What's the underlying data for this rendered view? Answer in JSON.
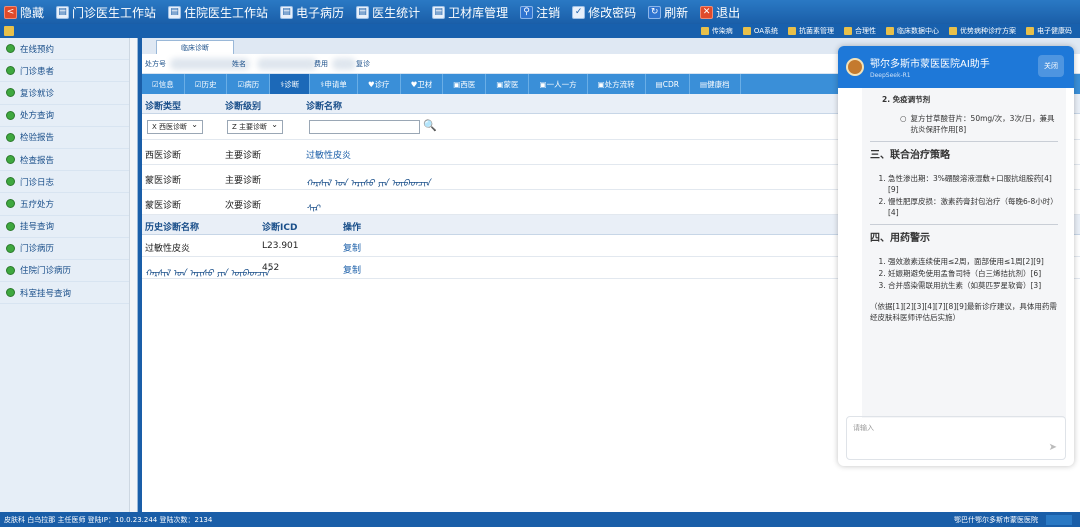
{
  "toolbar": {
    "items": [
      {
        "label": "隐藏",
        "icon": "hide-icon"
      },
      {
        "label": "门诊医生工作站",
        "icon": "outpatient-icon"
      },
      {
        "label": "住院医生工作站",
        "icon": "inpatient-icon"
      },
      {
        "label": "电子病历",
        "icon": "emr-icon"
      },
      {
        "label": "医生统计",
        "icon": "stats-icon"
      },
      {
        "label": "卫材库管理",
        "icon": "supplies-icon"
      },
      {
        "label": "注销",
        "icon": "logout-icon"
      },
      {
        "label": "修改密码",
        "icon": "password-icon"
      },
      {
        "label": "刷新",
        "icon": "refresh-icon"
      },
      {
        "label": "退出",
        "icon": "exit-icon"
      }
    ]
  },
  "subbar": {
    "items": [
      "传染病",
      "OA系统",
      "抗菌素管理",
      "合理性",
      "临床数据中心",
      "优势病种诊疗方案",
      "电子健康码"
    ]
  },
  "sidebar": {
    "items": [
      "在线预约",
      "门诊患者",
      "复诊就诊",
      "处方查询",
      "检验报告",
      "检查报告",
      "门诊日志",
      "五疗处方",
      "挂号查询",
      "门诊病历",
      "住院门诊病历",
      "科室挂号查询"
    ]
  },
  "main": {
    "tab": "临床诊断",
    "info_labels": [
      "处方号",
      "姓名",
      "费用",
      "复诊"
    ],
    "nav": [
      "信息",
      "历史",
      "病历",
      "诊断",
      "申请单",
      "诊疗",
      "卫材",
      "西医",
      "蒙医",
      "一人一方",
      "处方流转",
      "CDR",
      "健康档"
    ],
    "dx_headers": {
      "type": "诊断类型",
      "level": "诊断级别",
      "name": "诊断名称"
    },
    "dx_select_type": "X 西医诊断",
    "dx_select_level": "Z 主要诊断",
    "dx_rows": [
      {
        "type": "西医诊断",
        "level": "主要诊断",
        "name": "过敏性皮炎"
      },
      {
        "type": "蒙医诊断",
        "level": "主要诊断",
        "name": "ᠬᠠᠷᠰᠢᠯ ᠤᠨ ᠠᠷᠢᠰᠤ ᠶᠢᠨ ᠦᠪᠡᠳᠴᠢᠨ"
      },
      {
        "type": "蒙医诊断",
        "level": "次要诊断",
        "name": "ᠰᠢᠷ"
      }
    ],
    "hist_headers": {
      "name": "历史诊断名称",
      "icd": "诊断ICD",
      "op": "操作"
    },
    "hist_rows": [
      {
        "name": "过敏性皮炎",
        "icd": "L23.901",
        "op": "复制"
      },
      {
        "name": "ᠬᠠᠷᠰᠢᠯ ᠤᠨ ᠠᠷᠢᠰᠤ ᠶᠢᠨ ᠦᠪᠡᠳᠴᠢᠨ",
        "icd": "452",
        "op": "复制"
      }
    ]
  },
  "chat": {
    "title": "鄂尔多斯市蒙医医院AI助手",
    "subtitle": "DeepSeek-R1",
    "close": "关闭",
    "item2_title": "2. 免疫调节剂",
    "item2_bullet": "复方甘草酸苷片：50mg/次，3次/日，兼具抗炎保肝作用[8]",
    "h3_title": "三、联合治疗策略",
    "h3_list": [
      "急性渗出期：3%硼酸溶液湿敷+口服抗组胺药[4][9]",
      "慢性肥厚皮损：激素药膏封包治疗（每晚6-8小时）[4]"
    ],
    "h4_title": "四、用药警示",
    "h4_list": [
      "强效激素连续使用≤2周，面部使用≤1周[2][9]",
      "妊娠期避免使用孟鲁司特（白三烯拮抗剂）[6]",
      "合并感染需联用抗生素（如莫匹罗星软膏）[3]"
    ],
    "footnote": "（依据[1][2][3][4][7][8][9]最新诊疗建议，具体用药需经皮肤科医师评估后实施）",
    "input_placeholder": "请输入"
  },
  "status": {
    "left": "皮肤科 白乌拉那 主任医师 登陆IP：10.0.23.244 登陆次数：2134",
    "right": "鄂巴什鄂尔多斯市蒙医医院"
  },
  "colors": {
    "brand": "#1a5ea8",
    "accent": "#3a8fd8",
    "chat_header": "#1e78d8"
  }
}
